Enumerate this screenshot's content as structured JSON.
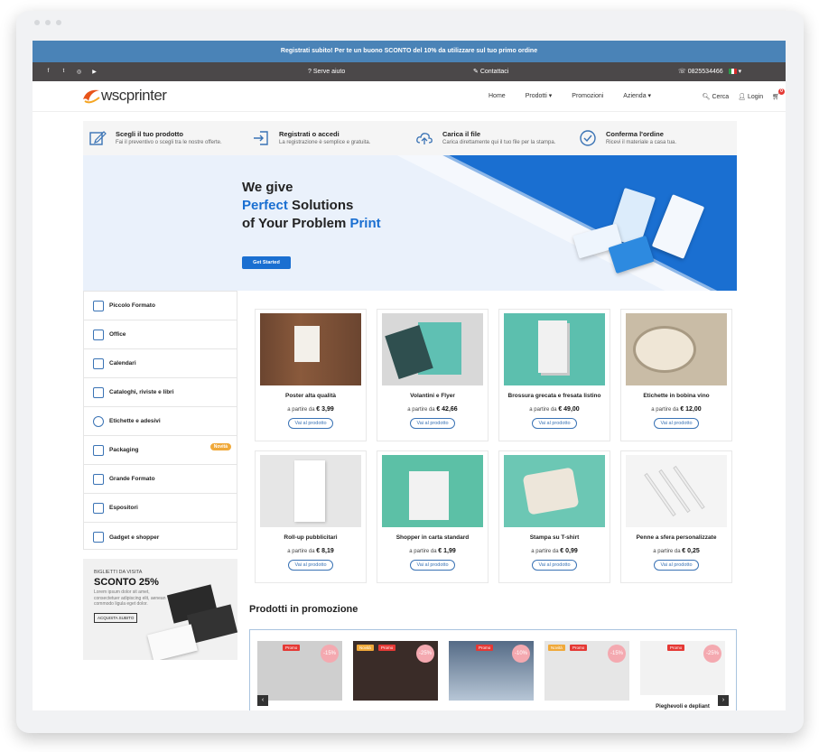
{
  "topbar": {
    "message": "Registrati subito! Per te un buono SCONTO del 10% da utilizzare sul tuo primo ordine"
  },
  "infobar": {
    "help": "Serve aiuto",
    "contact": "Contattaci",
    "phone": "0825534466"
  },
  "nav": {
    "logo": "wscprinter",
    "items": [
      "Home",
      "Prodotti",
      "Promozioni",
      "Azienda"
    ],
    "search": "Cerca",
    "login": "Login",
    "cart_count": "0"
  },
  "steps": [
    {
      "title": "Scegli il tuo prodotto",
      "desc": "Fai il preventivo o scegli tra le nostre offerte."
    },
    {
      "title": "Registrati o accedi",
      "desc": "La registrazione è semplice e gratuita."
    },
    {
      "title": "Carica il file",
      "desc": "Carica direttamente qui il tuo file per la stampa."
    },
    {
      "title": "Conferma l'ordine",
      "desc": "Ricevi il materiale a casa tua."
    }
  ],
  "hero": {
    "line1": "We give",
    "line2_hl": "Perfect",
    "line2_rest": " Solutions",
    "line3_rest": "of Your Problem ",
    "line3_hl": "Print",
    "button": "Get Started"
  },
  "sidebar": [
    {
      "label": "Piccolo Formato"
    },
    {
      "label": "Office"
    },
    {
      "label": "Calendari"
    },
    {
      "label": "Cataloghi, riviste e libri"
    },
    {
      "label": "Etichette e adesivi"
    },
    {
      "label": "Packaging",
      "badge": "Novità"
    },
    {
      "label": "Grande Formato"
    },
    {
      "label": "Espositori"
    },
    {
      "label": "Gadget e shopper"
    }
  ],
  "side_promo": {
    "small": "BIGLIETTI DA VISITA",
    "big": "SCONTO 25%",
    "text": "Lorem ipsum dolor sit amet, consectetuer adipiscing elit, aenean commodo ligula eget dolor.",
    "button": "ACQUISTA SUBITO"
  },
  "products_common": {
    "from": "a partire da",
    "button": "Vai al prodotto"
  },
  "products": [
    {
      "name": "Poster alta qualità",
      "price": "€ 3,99"
    },
    {
      "name": "Volantini e Flyer",
      "price": "€ 42,66"
    },
    {
      "name": "Brossura grecata e fresata listino",
      "price": "€ 49,00"
    },
    {
      "name": "Etichette in bobina vino",
      "price": "€ 12,00"
    },
    {
      "name": "Roll-up pubblicitari",
      "price": "€ 8,19"
    },
    {
      "name": "Shopper in carta standard",
      "price": "€ 1,99"
    },
    {
      "name": "Stampa su T-shirt",
      "price": "€ 0,99"
    },
    {
      "name": "Penne a sfera personalizzate",
      "price": "€ 0,25"
    }
  ],
  "promo_section": {
    "title": "Prodotti in promozione",
    "tag": "Promo",
    "new_tag": "Novità",
    "items": [
      {
        "discount": "-15%"
      },
      {
        "discount": "-25%"
      },
      {
        "discount": "-10%"
      },
      {
        "discount": "-15%"
      },
      {
        "discount": "-25%",
        "name": "Pieghevoli e depliant"
      }
    ]
  },
  "colors": {
    "accent": "#1a6fd1",
    "topbar": "#4a83b7",
    "infobar": "#4b4849"
  }
}
